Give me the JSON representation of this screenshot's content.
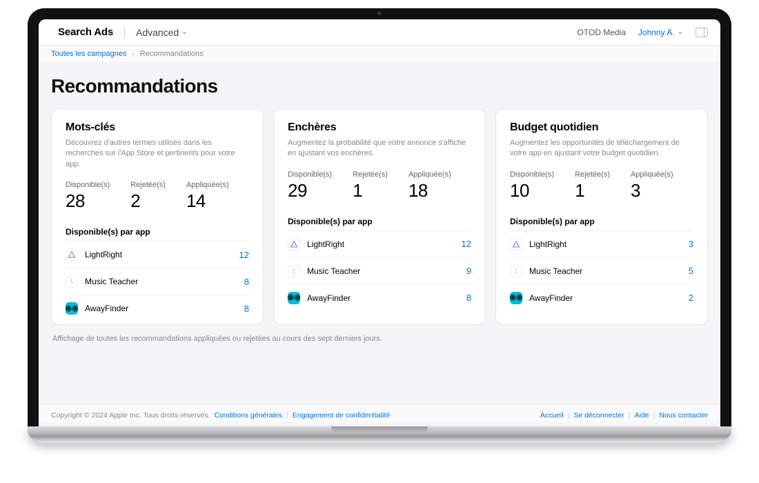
{
  "header": {
    "product": "Search Ads",
    "mode": "Advanced",
    "org": "OTOD Media",
    "user": "Johnny A."
  },
  "breadcrumb": {
    "root": "Toutes les campagnes",
    "current": "Recommandations"
  },
  "page": {
    "title": "Recommandations",
    "note": "Affichage de toutes les recommandations appliquées ou rejetées au cours des sept derniers jours."
  },
  "labels": {
    "available": "Disponible(s)",
    "rejected": "Rejetée(s)",
    "applied": "Appliquée(s)",
    "per_app": "Disponible(s) par app"
  },
  "cards": [
    {
      "title": "Mots-clés",
      "desc": "Découvrez d'autres termes utilisés dans les recherches sur l'App Store et pertinents pour votre app.",
      "available": "28",
      "rejected": "2",
      "applied": "14",
      "apps": [
        {
          "name": "LightRight",
          "count": "12",
          "icon": "light"
        },
        {
          "name": "Music Teacher",
          "count": "8",
          "icon": "music"
        },
        {
          "name": "AwayFinder",
          "count": "8",
          "icon": "away"
        }
      ]
    },
    {
      "title": "Enchères",
      "desc": "Augmentez la probabilité que votre annonce s'affiche en ajustant vos enchères.",
      "available": "29",
      "rejected": "1",
      "applied": "18",
      "apps": [
        {
          "name": "LightRight",
          "count": "12",
          "icon": "light"
        },
        {
          "name": "Music Teacher",
          "count": "9",
          "icon": "music"
        },
        {
          "name": "AwayFinder",
          "count": "8",
          "icon": "away"
        }
      ]
    },
    {
      "title": "Budget quotidien",
      "desc": "Augmentez les opportunités de téléchargement de votre app en ajustant votre budget quotidien.",
      "available": "10",
      "rejected": "1",
      "applied": "3",
      "apps": [
        {
          "name": "LightRight",
          "count": "3",
          "icon": "light"
        },
        {
          "name": "Music Teacher",
          "count": "5",
          "icon": "music"
        },
        {
          "name": "AwayFinder",
          "count": "2",
          "icon": "away"
        }
      ]
    }
  ],
  "footer": {
    "copyright": "Copyright © 2024 Apple Inc. Tous droits réservés.",
    "terms": "Conditions générales",
    "privacy": "Engagement de confidentialité",
    "home": "Accueil",
    "signout": "Se déconnecter",
    "help": "Aide",
    "contact": "Nous contacter"
  }
}
